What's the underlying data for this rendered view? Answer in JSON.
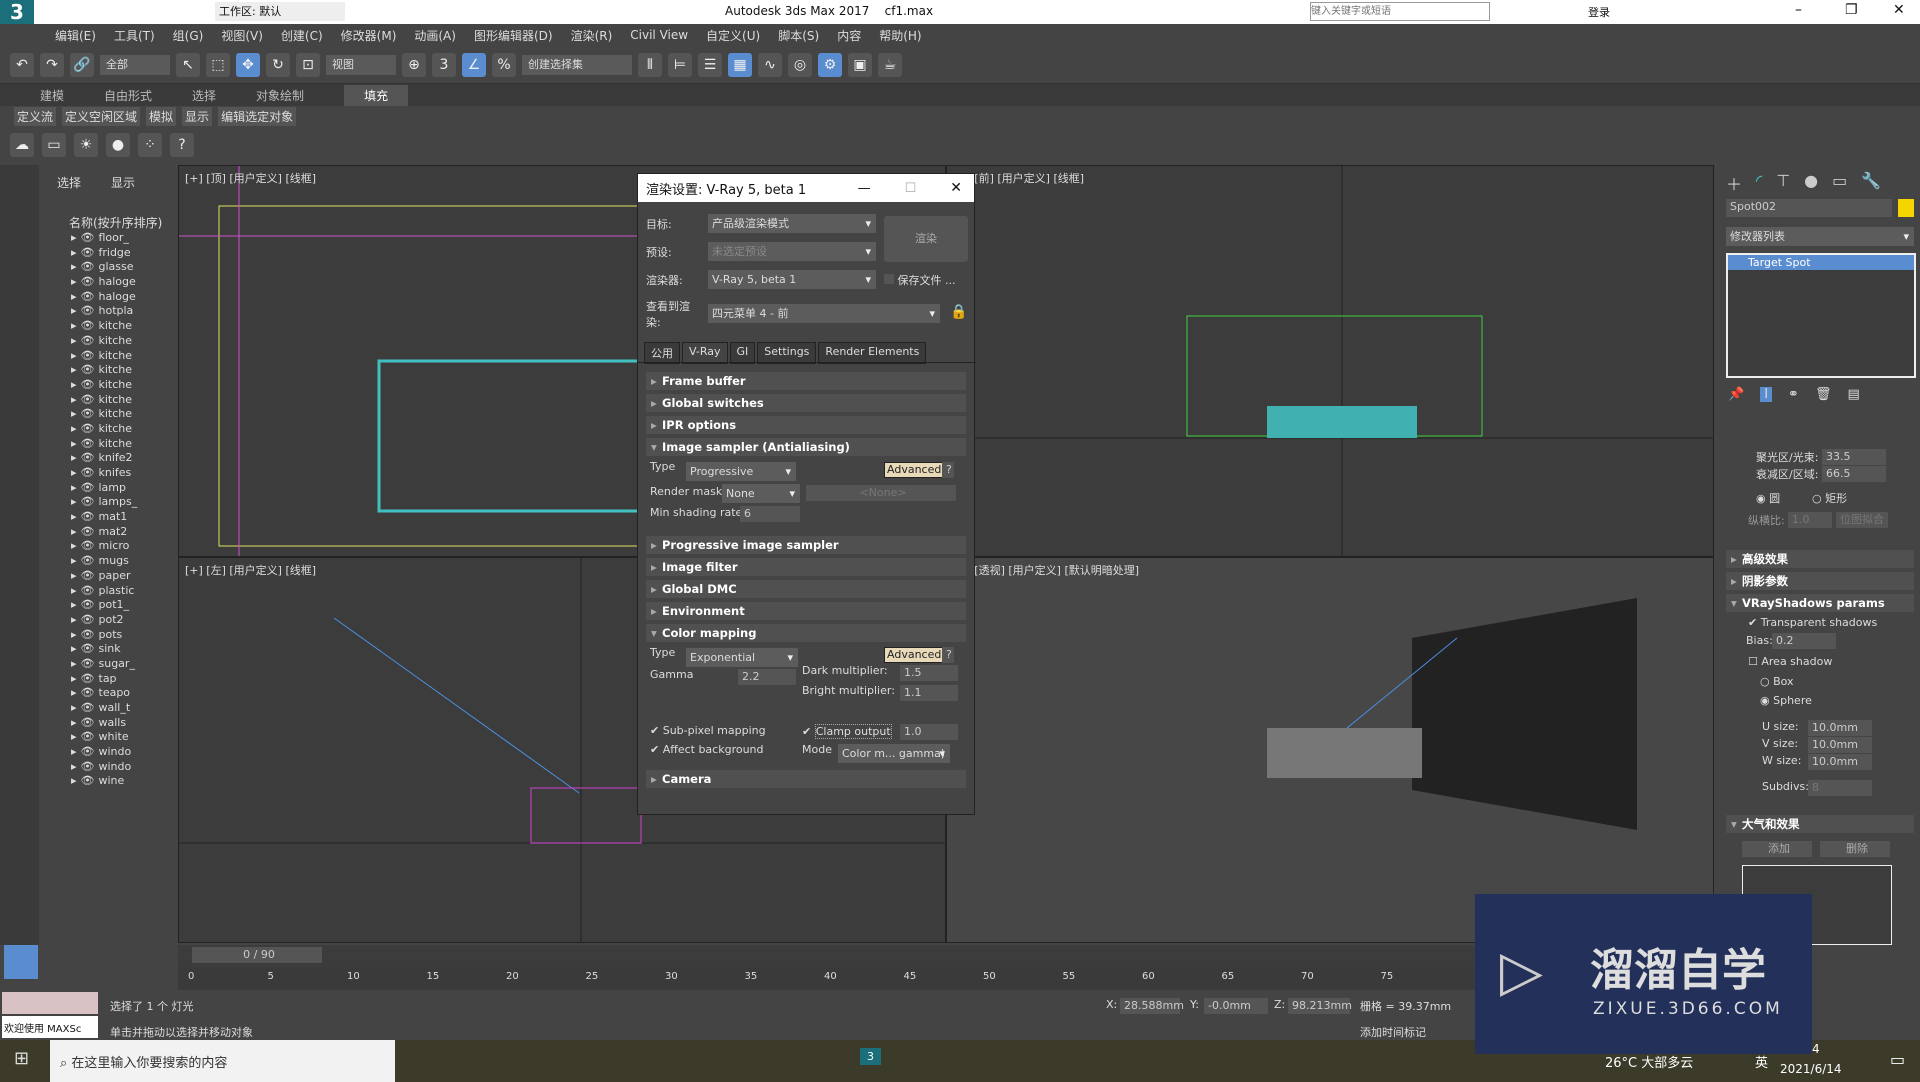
{
  "titlebar": {
    "app_logo": "3",
    "workspace": "工作区: 默认",
    "title": "Autodesk 3ds Max 2017",
    "file": "cf1.max",
    "search_placeholder": "键入关键字或短语",
    "login": "登录"
  },
  "menu": [
    "编辑(E)",
    "工具(T)",
    "组(G)",
    "视图(V)",
    "创建(C)",
    "修改器(M)",
    "动画(A)",
    "图形编辑器(D)",
    "渲染(R)",
    "Civil View",
    "自定义(U)",
    "脚本(S)",
    "内容",
    "帮助(H)"
  ],
  "toolbar": {
    "filter": "全部",
    "view": "视图",
    "selection_set": "创建选择集"
  },
  "ribbon": {
    "tabs": [
      "建模",
      "自由形式",
      "选择",
      "对象绘制",
      "填充"
    ],
    "active": "填充",
    "subtabs": [
      "定义流",
      "定义空闲区域",
      "模拟",
      "显示",
      "编辑选定对象"
    ]
  },
  "explorer": {
    "tabs": [
      "选择",
      "显示"
    ],
    "column": "名称(按升序排序)",
    "items": [
      "floor_",
      "fridge",
      "glasse",
      "haloge",
      "haloge",
      "hotpla",
      "kitche",
      "kitche",
      "kitche",
      "kitche",
      "kitche",
      "kitche",
      "kitche",
      "kitche",
      "kitche",
      "knife2",
      "knifes",
      "lamp",
      "lamps_",
      "mat1",
      "mat2",
      "micro",
      "mugs",
      "paper",
      "plastic",
      "pot1_",
      "pot2",
      "pots",
      "sink",
      "sugar_",
      "tap",
      "teapo",
      "wall_t",
      "walls",
      "white",
      "windo",
      "windo",
      "wine"
    ]
  },
  "viewports": {
    "top": "[+] [顶] [用户定义] [线框]",
    "front": "[+] [前] [用户定义] [线框]",
    "left": "[+] [左] [用户定义] [线框]",
    "perspective": "[+] [透视] [用户定义] [默认明暗处理]"
  },
  "dialog": {
    "title": "渲染设置: V-Ray 5, beta 1",
    "target_label": "目标:",
    "target": "产品级渲染模式",
    "preset_label": "预设:",
    "preset": "未选定预设",
    "renderer_label": "渲染器:",
    "renderer": "V-Ray 5, beta 1",
    "save_file": "保存文件",
    "more": "...",
    "view_label": "查看到渲染:",
    "view": "四元菜单 4 - 前",
    "render_button": "渲染",
    "tabs": [
      "公用",
      "V-Ray",
      "GI",
      "Settings",
      "Render Elements"
    ],
    "active_tab": "V-Ray",
    "rollouts": {
      "frame_buffer": "Frame buffer",
      "global_switches": "Global switches",
      "ipr": "IPR options",
      "image_sampler": "Image sampler (Antialiasing)",
      "progressive": "Progressive image sampler",
      "image_filter": "Image filter",
      "global_dmc": "Global DMC",
      "environment": "Environment",
      "color_mapping": "Color mapping",
      "camera": "Camera"
    },
    "sampler": {
      "type_label": "Type",
      "type": "Progressive",
      "advanced": "Advanced",
      "help": "?",
      "mask_label": "Render mask",
      "mask": "None",
      "mask_obj": "<None>",
      "msr_label": "Min shading rate",
      "msr": "6"
    },
    "color_mapping": {
      "type_label": "Type",
      "type": "Exponential",
      "advanced": "Advanced",
      "help": "?",
      "gamma_label": "Gamma",
      "gamma": "2.2",
      "dark_label": "Dark multiplier:",
      "dark": "1.5",
      "bright_label": "Bright multiplier:",
      "bright": "1.1",
      "subpixel": "Sub-pixel mapping",
      "affect_bg": "Affect background",
      "clamp": "Clamp output",
      "clamp_val": "1.0",
      "mode_label": "Mode",
      "mode": "Color m... gamma)"
    }
  },
  "command_panel": {
    "object_name": "Spot002",
    "object_color": "#f5d400",
    "modifier_list": "修改器列表",
    "stack": [
      "Target Spot"
    ],
    "hotspot_label": "聚光区/光束:",
    "hotspot": "33.5",
    "falloff_label": "衰减区/区域:",
    "falloff": "66.5",
    "circle": "圆",
    "rect": "矩形",
    "aspect_label": "纵横比:",
    "aspect": "1.0",
    "bitmap_fit": "位图拟合",
    "advanced_effects": "高级效果",
    "shadow_params": "阴影参数",
    "vray_shadows": {
      "title": "VRayShadows params",
      "transparent": "Transparent shadows",
      "bias_label": "Bias:",
      "bias": "0.2",
      "area": "Area shadow",
      "box": "Box",
      "sphere": "Sphere",
      "u_label": "U size:",
      "u": "10.0mm",
      "v_label": "V size:",
      "v": "10.0mm",
      "w_label": "W size:",
      "w": "10.0mm",
      "subdivs_label": "Subdivs:",
      "subdivs": "8"
    },
    "atmos": {
      "title": "大气和效果",
      "add": "添加",
      "delete": "删除"
    }
  },
  "timeline": {
    "frame": "0 / 90",
    "ticks": [
      "0",
      "5",
      "10",
      "15",
      "20",
      "25",
      "30",
      "35",
      "40",
      "45",
      "50",
      "55",
      "60",
      "65",
      "70",
      "75"
    ]
  },
  "status": {
    "maxscript": "欢迎使用 MAXSc",
    "selected": "选择了 1 个 灯光",
    "hint": "单击并拖动以选择并移动对象",
    "x_label": "X:",
    "x": "28.588mm",
    "y_label": "Y:",
    "y": "-0.0mm",
    "z_label": "Z:",
    "z": "98.213mm",
    "grid": "栅格 = 39.37mm",
    "add_tag": "添加时间标记"
  },
  "taskbar": {
    "search": "在这里输入你要搜索的内容",
    "weather": "26°C 大部多云",
    "ime": "英",
    "time": "21:54",
    "date": "2021/6/14"
  },
  "watermark": {
    "brand": "溜溜自学",
    "url": "ZIXUE.3D66.COM"
  }
}
